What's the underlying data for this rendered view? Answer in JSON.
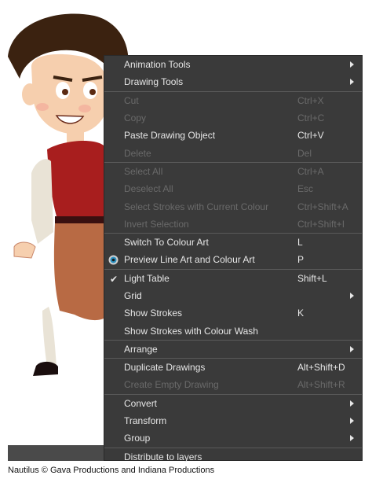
{
  "caption": "Nautilus © Gava Productions and Indiana Productions",
  "menu": {
    "groups": [
      [
        {
          "label": "Animation Tools",
          "shortcut": "",
          "submenu": true,
          "disabled": false
        },
        {
          "label": "Drawing Tools",
          "shortcut": "",
          "submenu": true,
          "disabled": false
        }
      ],
      [
        {
          "label": "Cut",
          "shortcut": "Ctrl+X",
          "submenu": false,
          "disabled": true
        },
        {
          "label": "Copy",
          "shortcut": "Ctrl+C",
          "submenu": false,
          "disabled": true
        },
        {
          "label": "Paste Drawing Object",
          "shortcut": "Ctrl+V",
          "submenu": false,
          "disabled": false
        },
        {
          "label": "Delete",
          "shortcut": "Del",
          "submenu": false,
          "disabled": true
        }
      ],
      [
        {
          "label": "Select All",
          "shortcut": "Ctrl+A",
          "submenu": false,
          "disabled": true
        },
        {
          "label": "Deselect All",
          "shortcut": "Esc",
          "submenu": false,
          "disabled": true
        },
        {
          "label": "Select Strokes with Current Colour",
          "shortcut": "Ctrl+Shift+A",
          "submenu": false,
          "disabled": true
        },
        {
          "label": "Invert Selection",
          "shortcut": "Ctrl+Shift+I",
          "submenu": false,
          "disabled": true
        }
      ],
      [
        {
          "label": "Switch To Colour Art",
          "shortcut": "L",
          "submenu": false,
          "disabled": false
        },
        {
          "label": "Preview Line Art and Colour Art",
          "shortcut": "P",
          "submenu": false,
          "disabled": false,
          "icon": "eye-icon"
        }
      ],
      [
        {
          "label": "Light Table",
          "shortcut": "Shift+L",
          "submenu": false,
          "disabled": false,
          "checked": true
        },
        {
          "label": "Grid",
          "shortcut": "",
          "submenu": true,
          "disabled": false
        },
        {
          "label": "Show Strokes",
          "shortcut": "K",
          "submenu": false,
          "disabled": false
        },
        {
          "label": "Show Strokes with Colour Wash",
          "shortcut": "",
          "submenu": false,
          "disabled": false
        }
      ],
      [
        {
          "label": "Arrange",
          "shortcut": "",
          "submenu": true,
          "disabled": false
        }
      ],
      [
        {
          "label": "Duplicate Drawings",
          "shortcut": "Alt+Shift+D",
          "submenu": false,
          "disabled": false
        },
        {
          "label": "Create Empty Drawing",
          "shortcut": "Alt+Shift+R",
          "submenu": false,
          "disabled": true
        }
      ],
      [
        {
          "label": "Convert",
          "shortcut": "",
          "submenu": true,
          "disabled": false
        },
        {
          "label": "Transform",
          "shortcut": "",
          "submenu": true,
          "disabled": false
        },
        {
          "label": "Group",
          "shortcut": "",
          "submenu": true,
          "disabled": false
        }
      ],
      [
        {
          "label": "Distribute to layers",
          "shortcut": "",
          "submenu": false,
          "disabled": false
        }
      ]
    ]
  },
  "colors": {
    "menu_bg": "#3a3a3a",
    "menu_text": "#e6e6e6",
    "menu_disabled": "#6a6a6a",
    "separator": "#5a5a5a"
  }
}
